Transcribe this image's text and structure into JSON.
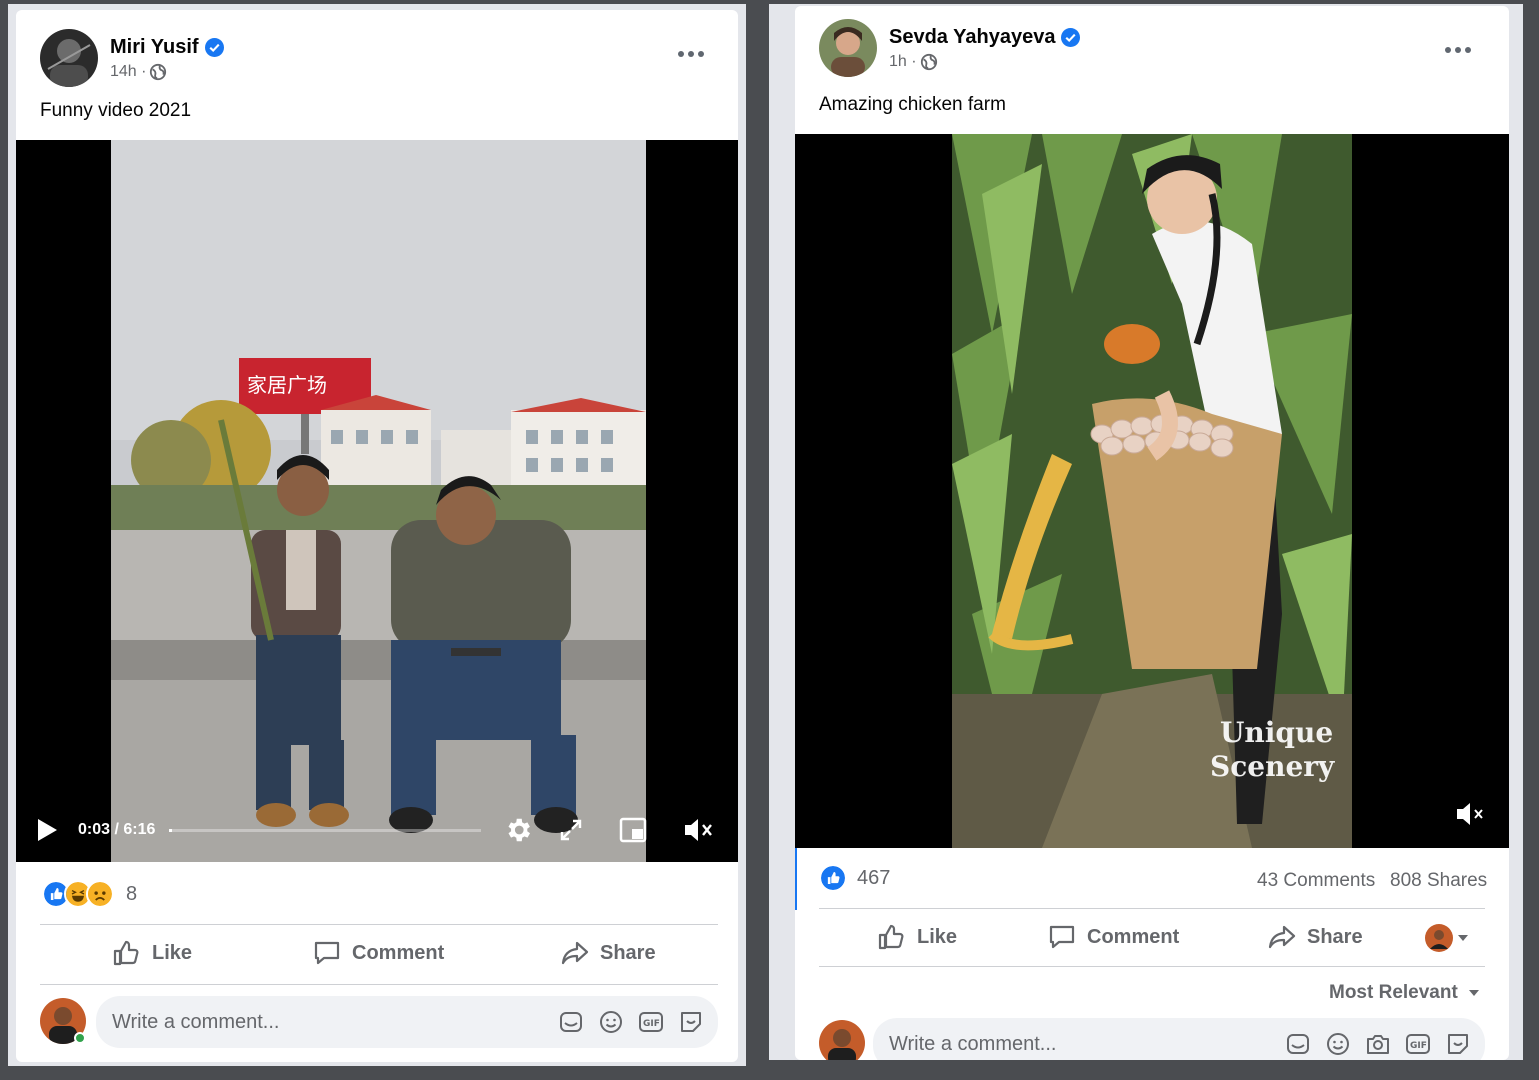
{
  "post_left": {
    "author": "Miri Yusif",
    "time": "14h ·",
    "text": "Funny video 2021",
    "video_time": "0:03 / 6:16",
    "video_progress": 0.008,
    "billboard_text": "家居广场",
    "reaction_count": "8",
    "actions": {
      "like": "Like",
      "comment": "Comment",
      "share": "Share"
    },
    "comment_placeholder": "Write a comment..."
  },
  "post_right": {
    "author": "Sevda Yahyayeva",
    "time": "1h ·",
    "text": "Amazing chicken farm",
    "watermark_line1": "Unique",
    "watermark_line2": "Scenery",
    "like_count": "467",
    "comments": "43 Comments",
    "shares": "808 Shares",
    "actions": {
      "like": "Like",
      "comment": "Comment",
      "share": "Share"
    },
    "sort_label": "Most Relevant",
    "comment_placeholder": "Write a comment..."
  },
  "colors": {
    "like_blue": "#1877f2",
    "haha_yellow": "#f7b125",
    "secondary_text": "#65676b"
  }
}
